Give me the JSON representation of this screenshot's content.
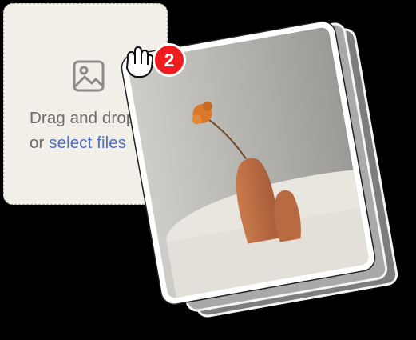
{
  "dropzone": {
    "icon": "image-icon",
    "line1": "Drag and drop",
    "line2_prefix": "or ",
    "line2_link": "select files"
  },
  "drag": {
    "cursor_icon": "grab-hand-cursor-icon",
    "count": "2",
    "badge_color": "#ee1c1c"
  },
  "colors": {
    "background": "#000000",
    "dropzone_bg": "#f1efe8",
    "link": "#4f6fc6"
  }
}
